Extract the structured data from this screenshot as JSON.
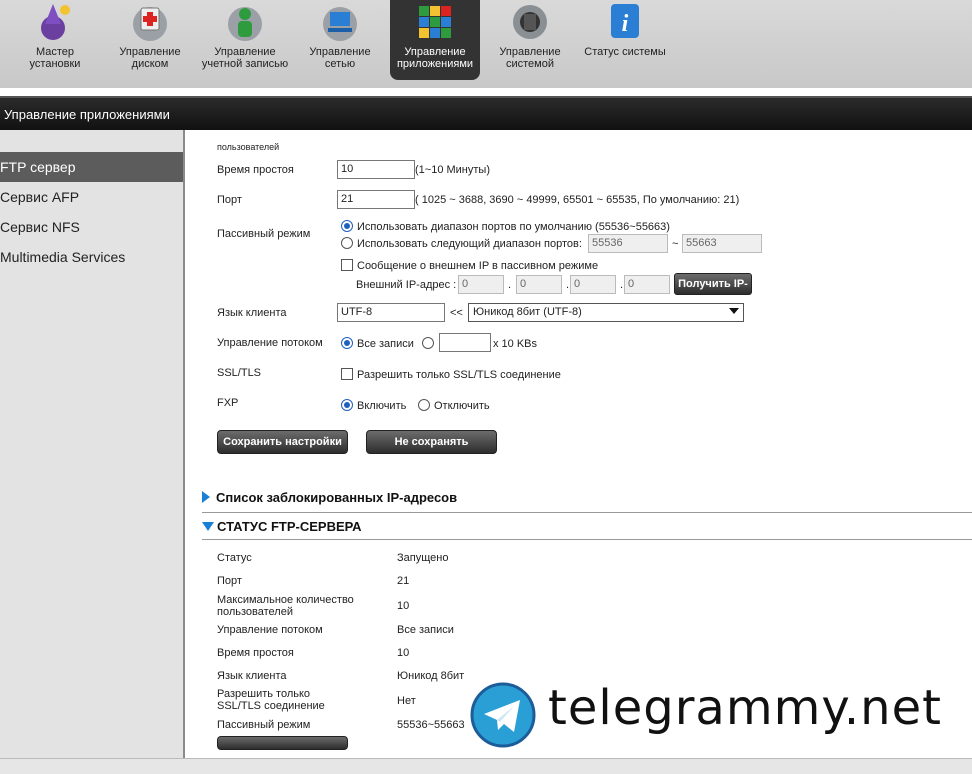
{
  "nav": {
    "items": [
      {
        "label1": "Мастер",
        "label2": "установки",
        "icon": "wizard-icon"
      },
      {
        "label1": "Управление",
        "label2": "диском",
        "icon": "disk-icon"
      },
      {
        "label1": "Управление",
        "label2": "учетной записью",
        "icon": "account-icon"
      },
      {
        "label1": "Управление",
        "label2": "сетью",
        "icon": "network-icon"
      },
      {
        "label1": "Управление",
        "label2": "приложениями",
        "icon": "apps-icon"
      },
      {
        "label1": "Управление",
        "label2": "системой",
        "icon": "system-icon"
      },
      {
        "label1": "Статус системы",
        "label2": "",
        "icon": "info-icon"
      }
    ]
  },
  "header": {
    "title": "Управление приложениями"
  },
  "sidebar": {
    "items": [
      {
        "label": "FTP сервер"
      },
      {
        "label": "Сервис AFP"
      },
      {
        "label": "Сервис NFS"
      },
      {
        "label": "Multimedia Services"
      }
    ]
  },
  "form": {
    "cut_label": "пользователей",
    "idle_label": "Время простоя",
    "idle_value": "10",
    "idle_hint": "(1~10 Минуты)",
    "port_label": "Порт",
    "port_value": "21",
    "port_hint": "( 1025 ~ 3688, 3690 ~ 49999, 65501 ~ 65535, По умолчанию: 21)",
    "passive_label": "Пассивный режим",
    "passive_opt1": "Использовать диапазон портов по умолчанию (55536~55663)",
    "passive_opt2": "Использовать следующий диапазон портов:",
    "range_from": "55536",
    "range_sep": "~",
    "range_to": "55663",
    "external_ip_check": "Сообщение о внешнем IP в пассивном режиме",
    "external_ip_label": "Внешний IP-адрес :",
    "ip_octets": [
      "0",
      "0",
      "0",
      "0"
    ],
    "ip_dot": ".",
    "get_ip_button": "Получить IP-",
    "client_lang_label": "Язык клиента",
    "client_lang_value": "UTF-8",
    "lang_arrows": "<<",
    "lang_select": "Юникод 8бит (UTF-8)",
    "flow_label": "Управление потоком",
    "flow_all": "Все записи",
    "flow_unit": "x 10 KBs",
    "ssl_label": "SSL/TLS",
    "ssl_check": "Разрешить только SSL/TLS соединение",
    "fxp_label": "FXP",
    "fxp_on": "Включить",
    "fxp_off": "Отключить",
    "save_button": "Сохранить настройки",
    "cancel_button": "Не сохранять"
  },
  "blocked": {
    "title": "Список заблокированных IP-адресов"
  },
  "status": {
    "title": "СТАТУС FTP-СЕРВЕРА",
    "rows": [
      {
        "label": "Статус",
        "value": "Запущено"
      },
      {
        "label": "Порт",
        "value": "21"
      },
      {
        "label": "Максимальное количество пользователей",
        "value": "10"
      },
      {
        "label": "Управление потоком",
        "value": "Все записи"
      },
      {
        "label": "Время простоя",
        "value": "10"
      },
      {
        "label": "Язык клиента",
        "value": "Юникод 8бит"
      },
      {
        "label": "Разрешить только SSL/TLS соединение",
        "value": "Нет"
      },
      {
        "label": "Пассивный режим",
        "value": "55536~55663"
      }
    ]
  },
  "watermark": {
    "text": "telegrammy.net"
  }
}
